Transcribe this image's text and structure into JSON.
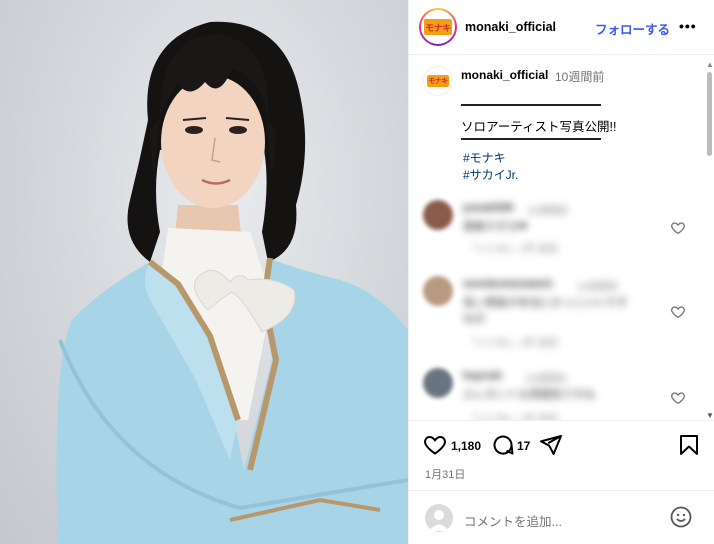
{
  "post": {
    "username": "monaki_official",
    "follow_label": "フォローする",
    "more_label": "•••",
    "logo_text": "モナキ",
    "caption": {
      "username": "monaki_official",
      "time": "10週間前",
      "text": "ソロアーティスト写真公開!!",
      "hashtags": [
        "#モナキ",
        "#サカイJr."
      ]
    },
    "comments": [
      {
        "user": "yuna0308",
        "time": "10週間前",
        "text": "素敵すぎる❤",
        "meta": "「いいね!」1件 返信"
      },
      {
        "user": "sonokomizutani1",
        "time": "10週間前",
        "lines": [
          "長い黒髪が本当にかっこいいです",
          "ね😊"
        ],
        "meta": "「いいね!」1件 返信"
      },
      {
        "user": "hayruki",
        "time": "10週間前",
        "text": "エレガントな雰囲気ですね",
        "meta": "「いいね!」1件 返信"
      }
    ],
    "likes": "1,180",
    "comments_count": "17",
    "date": "1月31日",
    "comment_placeholder": "コメントを追加..."
  },
  "colors": {
    "follow": "#3b57f5",
    "hashtag": "#00376b",
    "suit": "#a8d4e8",
    "trim": "#b8986a"
  },
  "icons": [
    "more-icon",
    "heart-icon",
    "comment-icon",
    "share-icon",
    "bookmark-icon",
    "emoji-icon",
    "user-icon"
  ]
}
